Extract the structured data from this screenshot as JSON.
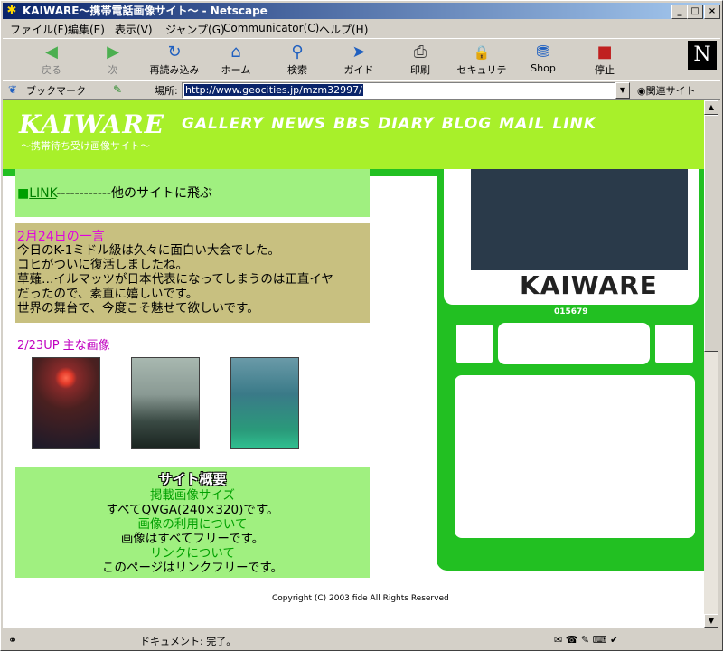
{
  "window": {
    "title": "KAIWARE～携帯電話画像サイト～ - Netscape",
    "min": "_",
    "max": "□",
    "close": "×"
  },
  "menu": [
    "ファイル(F)",
    "編集(E)",
    "表示(V)",
    "ジャンプ(G)",
    "Communicator(C)",
    "ヘルプ(H)"
  ],
  "toolbar": [
    {
      "label": "戻る",
      "icon": "◀"
    },
    {
      "label": "次",
      "icon": "▶"
    },
    {
      "label": "再読み込み",
      "icon": "↻"
    },
    {
      "label": "ホーム",
      "icon": "⌂"
    },
    {
      "label": "検索",
      "icon": "⚲"
    },
    {
      "label": "ガイド",
      "icon": "➤"
    },
    {
      "label": "印刷",
      "icon": "⎙"
    },
    {
      "label": "セキュリティ",
      "icon": "🔒"
    },
    {
      "label": "Shop",
      "icon": "⛃"
    },
    {
      "label": "停止",
      "icon": "■"
    }
  ],
  "brand_logo": "N",
  "location": {
    "bookmarks": "ブックマーク",
    "label": "場所:",
    "url": "http://www.geocities.jp/mzm32997/",
    "related": "関連サイト"
  },
  "page": {
    "logo": "KAIWARE",
    "logo_sub": "～携帯待ち受け画像サイト～",
    "nav": [
      "GALLERY",
      "NEWS",
      "BBS",
      "DIARY",
      "BLOG",
      "MAIL",
      "LINK"
    ],
    "link_row": {
      "bullet": "■",
      "link": "LINK",
      "dashes": "------------",
      "desc": "他のサイトに飛ぶ"
    },
    "hitokoto": {
      "head": "2月24日の一言",
      "lines": [
        "今日のK-1ミドル級は久々に面白い大会でした。",
        "コヒがついに復活しましたね。",
        "草薙…イルマッツが日本代表になってしまうのは正直イヤ",
        "だったので、素直に嬉しいです。",
        "世界の舞台で、今度こそ魅せて欲しいです。"
      ]
    },
    "update_head": "2/23UP 主な画像",
    "summary": {
      "title": "サイト概要",
      "lines": [
        {
          "t": "掲載画像サイズ",
          "green": true
        },
        {
          "t": "すべてQVGA(240×320)です。",
          "green": false
        },
        {
          "t": "画像の利用について",
          "green": true
        },
        {
          "t": "画像はすべてフリーです。",
          "green": false
        },
        {
          "t": "リンクについて",
          "green": true
        },
        {
          "t": "このページはリンクフリーです。",
          "green": false
        }
      ]
    },
    "copyright": "Copyright (C) 2003 fide All Rights Reserved",
    "side_logo": "KAIWARE",
    "counter": "015679"
  },
  "status": {
    "text": "ドキュメント: 完了。"
  }
}
